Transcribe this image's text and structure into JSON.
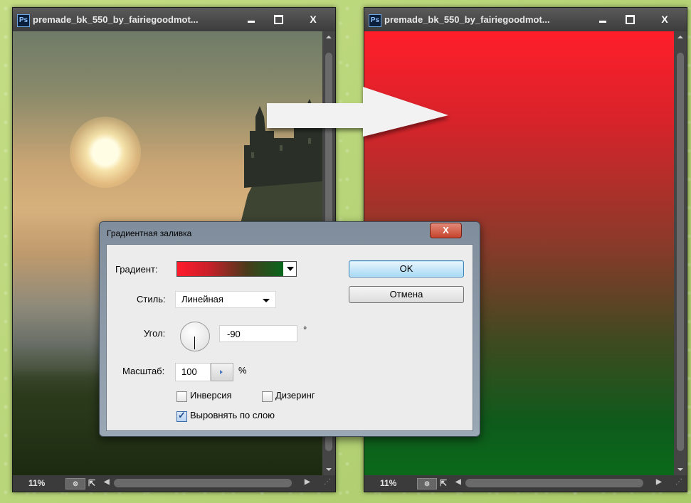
{
  "windows": [
    {
      "title": "premade_bk_550_by_fairiegoodmot...",
      "app_badge": "Ps",
      "close_label": "X",
      "zoom": "11%",
      "content": "photo"
    },
    {
      "title": "premade_bk_550_by_fairiegoodmot...",
      "app_badge": "Ps",
      "close_label": "X",
      "zoom": "11%",
      "content": "gradient",
      "gradient_colors": [
        "#ff1e2a",
        "#0a6a1a"
      ]
    }
  ],
  "dialog": {
    "title": "Градиентная заливка",
    "close_label": "X",
    "gradient_label": "Градиент:",
    "gradient_colors": [
      "#ff1b2c",
      "#06681c"
    ],
    "style_label": "Стиль:",
    "style_value": "Линейная",
    "angle_label": "Угол:",
    "angle_value": "-90",
    "angle_unit": "°",
    "scale_label": "Масштаб:",
    "scale_value": "100",
    "scale_unit": "%",
    "reverse_label": "Инверсия",
    "reverse_checked": false,
    "dither_label": "Дизеринг",
    "dither_checked": false,
    "align_label": "Выровнять по слою",
    "align_checked": true,
    "ok_label": "OK",
    "cancel_label": "Отмена"
  }
}
